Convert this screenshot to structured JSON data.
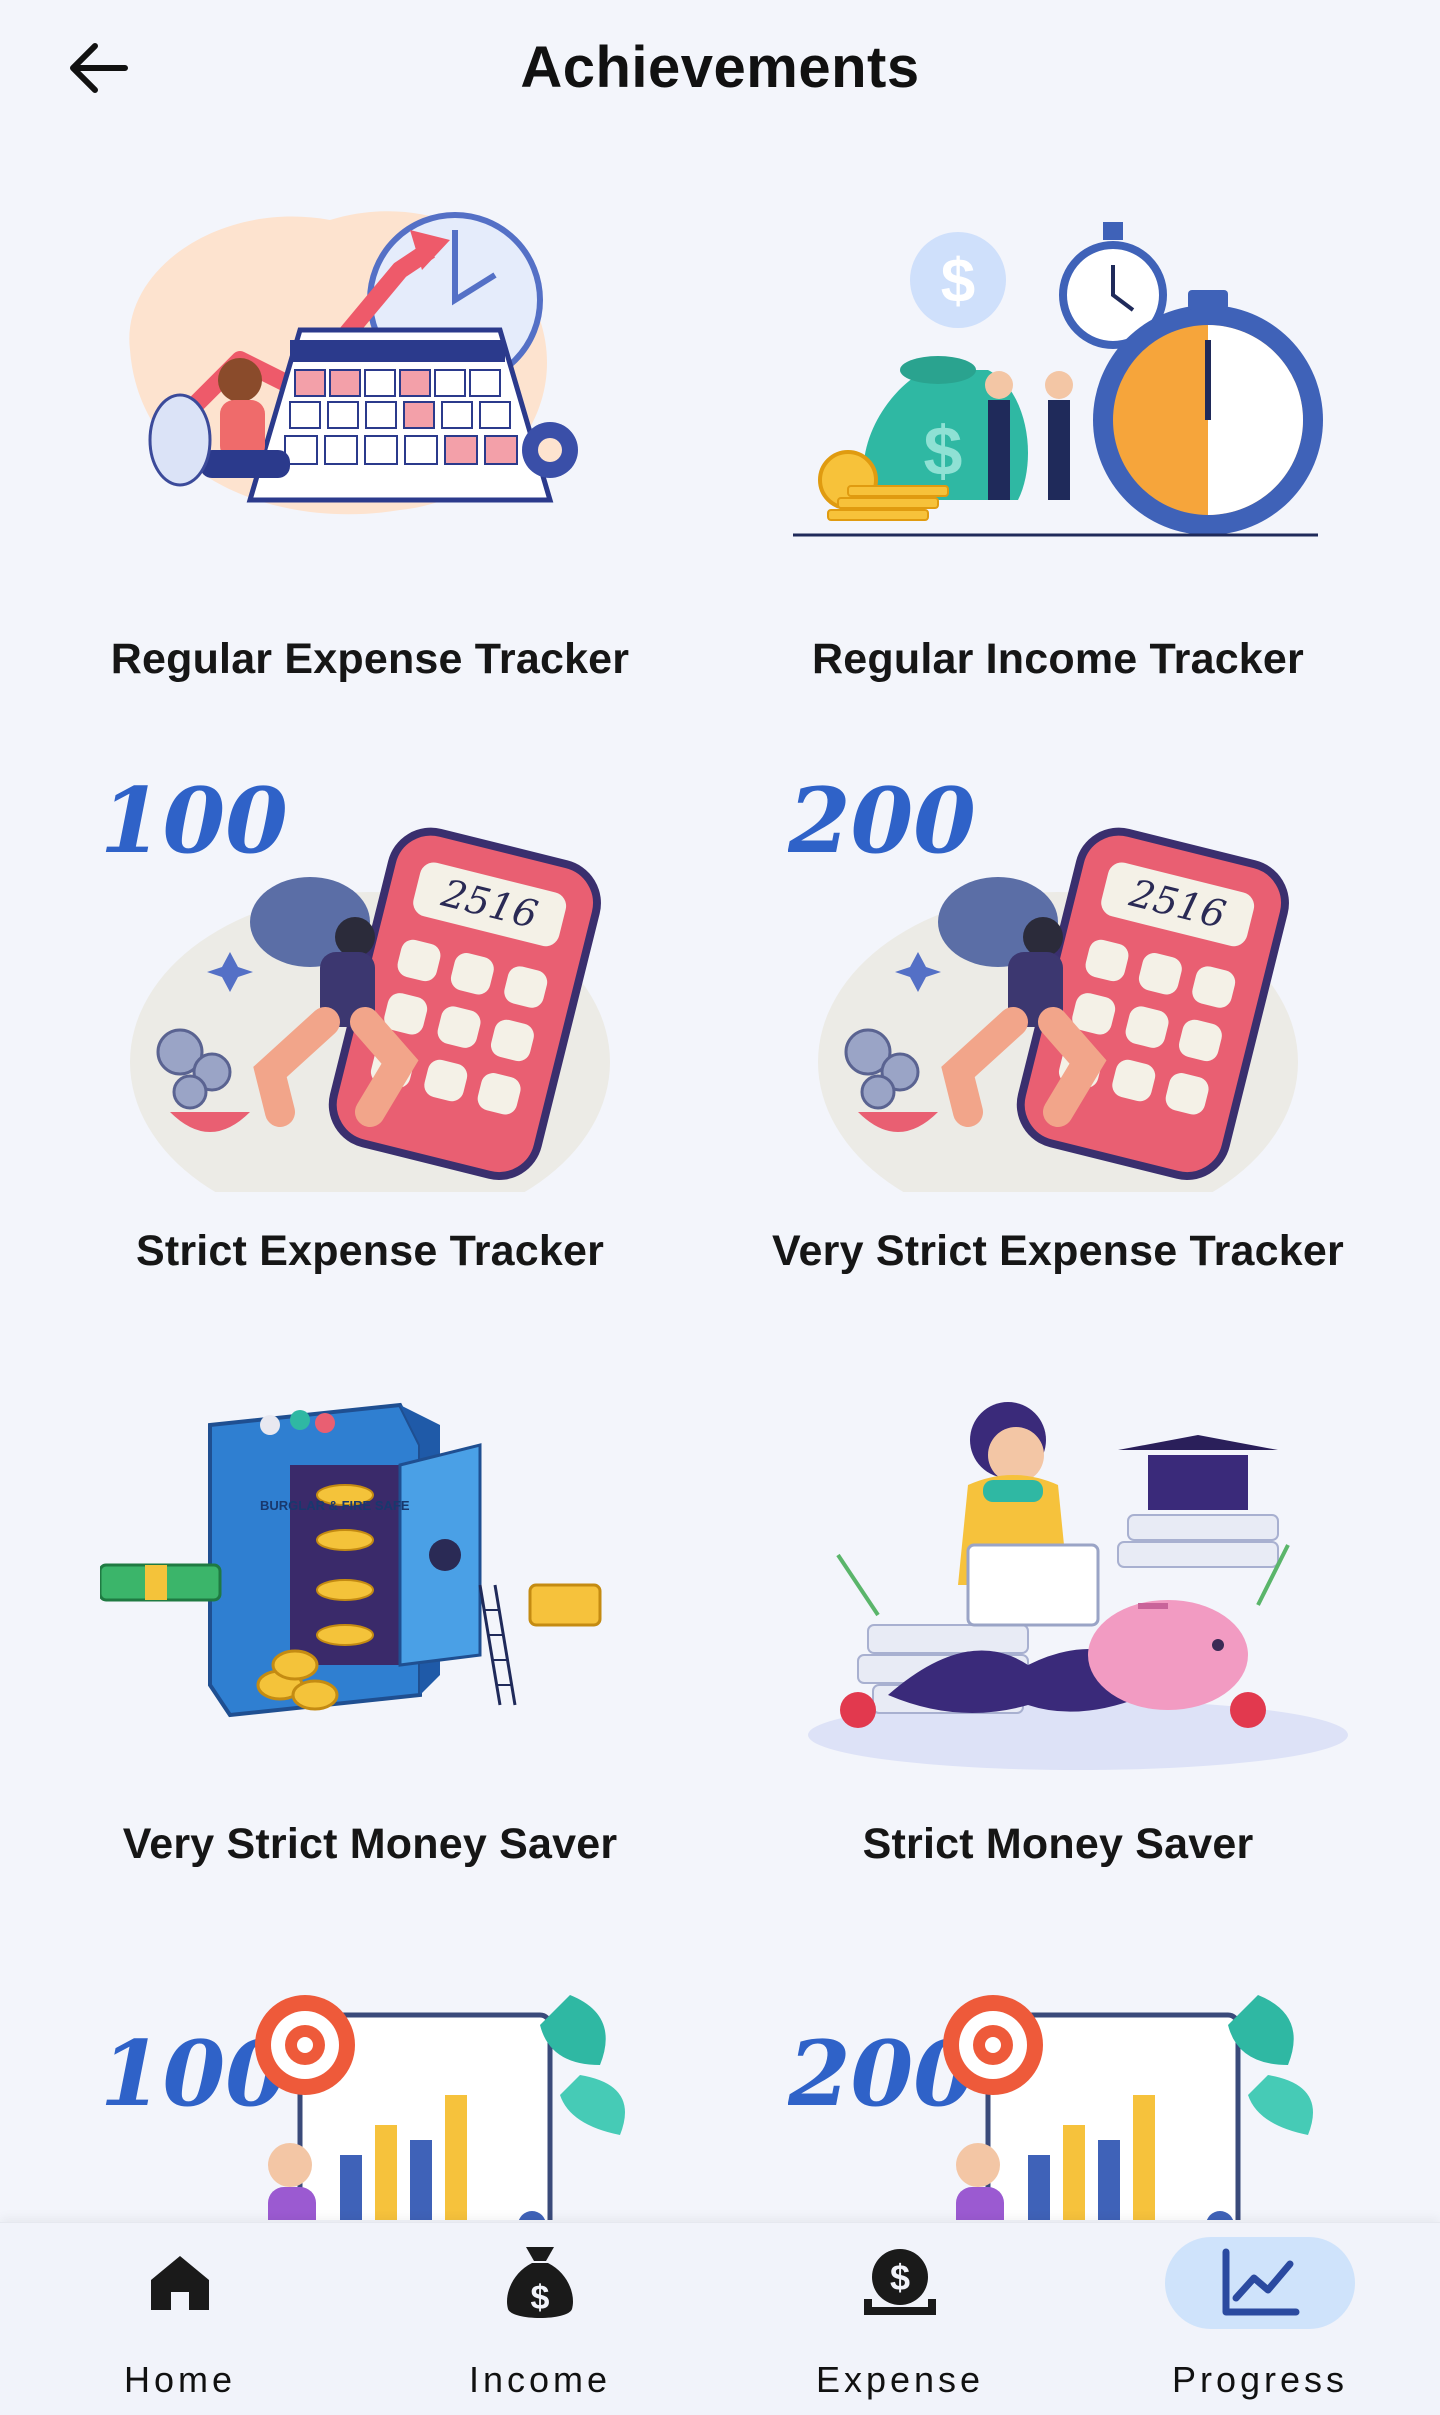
{
  "header": {
    "title": "Achievements",
    "back_icon": "arrow-left-icon"
  },
  "achievements": [
    {
      "label": "Regular Expense Tracker",
      "art": "calendar-growth-illustration"
    },
    {
      "label": "Regular Income Tracker",
      "art": "money-bag-stopwatch-illustration"
    },
    {
      "label": "Strict Expense Tracker",
      "art": "calculator-illustration",
      "badge": "100"
    },
    {
      "label": "Very Strict Expense Tracker",
      "art": "calculator-illustration",
      "badge": "200"
    },
    {
      "label": "Very Strict Money Saver",
      "art": "safe-vault-illustration"
    },
    {
      "label": "Strict Money Saver",
      "art": "piggy-bank-study-illustration"
    },
    {
      "label": "",
      "art": "target-chart-illustration",
      "badge": "100"
    },
    {
      "label": "",
      "art": "target-chart-illustration",
      "badge": "200"
    }
  ],
  "calculator_display": "2516",
  "safe_text": "BURGLAR & FIRE SAFE",
  "nav": {
    "items": [
      {
        "label": "Home",
        "icon": "home-icon"
      },
      {
        "label": "Income",
        "icon": "money-bag-icon"
      },
      {
        "label": "Expense",
        "icon": "dollar-coin-hand-icon"
      },
      {
        "label": "Progress",
        "icon": "trend-chart-icon"
      }
    ],
    "active": "Progress"
  },
  "colors": {
    "background": "#f3f5fb",
    "active_pill": "#cfe3fb",
    "accent_blue": "#2f62c8",
    "accent_red": "#e8596a"
  }
}
